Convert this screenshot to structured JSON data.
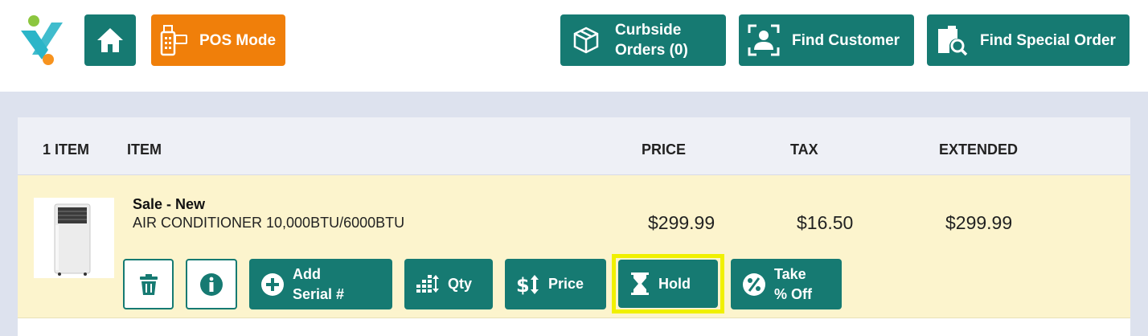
{
  "header": {
    "pos_mode_label": "POS Mode",
    "curbside_line1": "Curbside",
    "curbside_line2": "Orders (0)",
    "find_customer_label": "Find Customer",
    "find_special_order_label": "Find Special Order"
  },
  "table": {
    "headers": {
      "count": "1 ITEM",
      "item": "ITEM",
      "price": "PRICE",
      "tax": "TAX",
      "extended": "EXTENDED"
    },
    "rows": [
      {
        "title": "Sale - New",
        "description": "AIR CONDITIONER 10,000BTU/6000BTU",
        "price": "$299.99",
        "tax": "$16.50",
        "extended": "$299.99"
      }
    ]
  },
  "row_actions": {
    "add_serial_line1": "Add",
    "add_serial_line2": "Serial #",
    "qty_label": "Qty",
    "price_label": "Price",
    "hold_label": "Hold",
    "take_off_line1": "Take",
    "take_off_line2": "% Off"
  },
  "colors": {
    "teal": "#167a72",
    "orange": "#f07f0a",
    "row_highlight": "#fcf4cd",
    "hold_highlight": "#f0f000"
  }
}
